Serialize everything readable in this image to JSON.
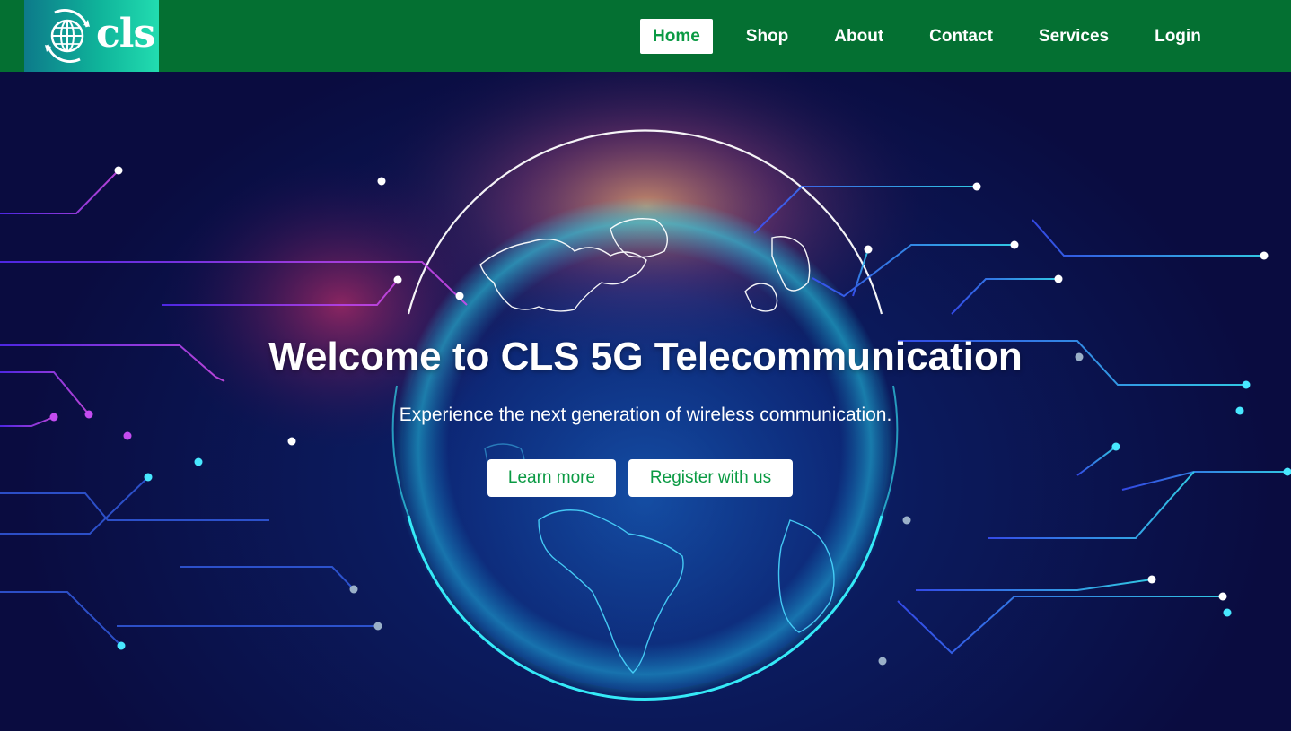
{
  "brand": {
    "logo_text": "cls",
    "logo_icon": "globe-cycle-icon"
  },
  "nav": {
    "items": [
      {
        "label": "Home",
        "active": true
      },
      {
        "label": "Shop",
        "active": false
      },
      {
        "label": "About",
        "active": false
      },
      {
        "label": "Contact",
        "active": false
      },
      {
        "label": "Services",
        "active": false
      },
      {
        "label": "Login",
        "active": false
      }
    ]
  },
  "hero": {
    "title": "Welcome to CLS 5G Telecommunication",
    "subtitle": "Experience the next generation of wireless communication.",
    "buttons": {
      "learn_more": "Learn more",
      "register": "Register with us"
    },
    "background_image": "glowing-globe-circuit-lines"
  },
  "colors": {
    "nav_bg": "#047032",
    "accent_green": "#0a9a43",
    "hero_dark": "#0a0c40",
    "glow_cyan": "#22f0ff",
    "glow_magenta": "#d02bd8"
  }
}
